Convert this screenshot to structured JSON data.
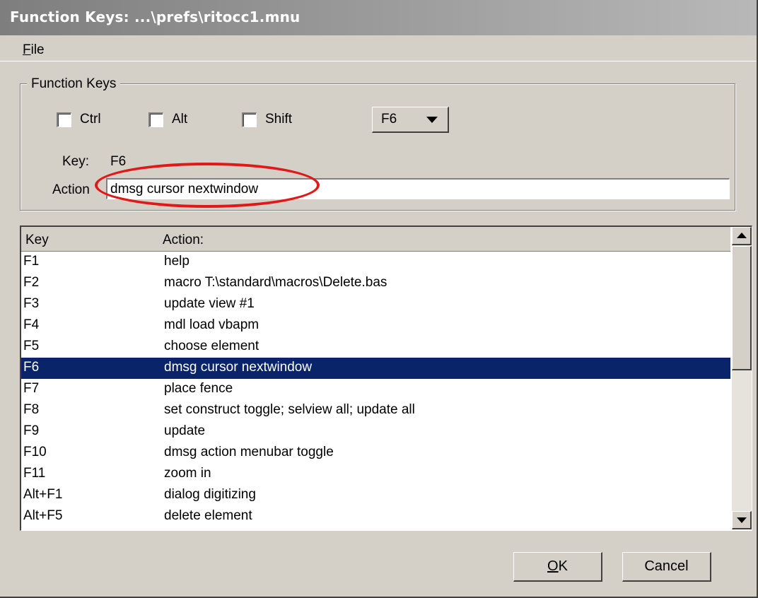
{
  "window": {
    "title": "Function Keys: ...\\prefs\\ritocc1.mnu"
  },
  "menubar": {
    "file": "File"
  },
  "group": {
    "legend": "Function Keys",
    "ctrl": "Ctrl",
    "alt": "Alt",
    "shift": "Shift",
    "key_select": "F6",
    "key_label": "Key:",
    "key_value": "F6",
    "action_label": "Action",
    "action_value": "dmsg cursor nextwindow"
  },
  "list": {
    "headers": {
      "key": "Key",
      "action": "Action:"
    },
    "rows": [
      {
        "key": "F1",
        "action": "help"
      },
      {
        "key": "F2",
        "action": "macro T:\\standard\\macros\\Delete.bas"
      },
      {
        "key": "F3",
        "action": "update view #1"
      },
      {
        "key": "F4",
        "action": "mdl load vbapm"
      },
      {
        "key": "F5",
        "action": "choose element"
      },
      {
        "key": "F6",
        "action": "dmsg cursor nextwindow"
      },
      {
        "key": "F7",
        "action": "place fence"
      },
      {
        "key": "F8",
        "action": "set construct toggle; selview all; update all"
      },
      {
        "key": "F9",
        "action": "update"
      },
      {
        "key": "F10",
        "action": "dmsg action menubar toggle"
      },
      {
        "key": "F11",
        "action": "zoom in"
      },
      {
        "key": "Alt+F1",
        "action": "dialog digitizing"
      },
      {
        "key": "Alt+F5",
        "action": "delete element"
      }
    ],
    "selected": "F6"
  },
  "buttons": {
    "ok": "OK",
    "cancel": "Cancel"
  },
  "colors": {
    "selection": "#0a246a",
    "highlight_ellipse": "#e01818",
    "dialog": "#d4d0c8"
  }
}
